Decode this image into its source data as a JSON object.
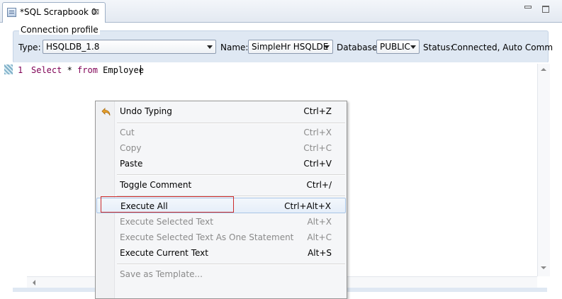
{
  "tab": {
    "title": "*SQL Scrapbook 0",
    "close": "⊠"
  },
  "connection": {
    "legend": "Connection profile",
    "type_label": "Type:",
    "type_value": "HSQLDB_1.8",
    "name_label": "Name:",
    "name_value": "SimpleHr HSQLDE",
    "database_label": "Database:",
    "database_value": "PUBLIC",
    "status_label": "Status:",
    "status_value": "Connected, Auto Comm"
  },
  "editor": {
    "line_number": "1",
    "kw_select": "Select",
    "mid": " * ",
    "kw_from": "from",
    "table": " Employee"
  },
  "menu": {
    "undo": {
      "label": "Undo Typing",
      "shortcut": "Ctrl+Z"
    },
    "cut": {
      "label": "Cut",
      "shortcut": "Ctrl+X"
    },
    "copy": {
      "label": "Copy",
      "shortcut": "Ctrl+C"
    },
    "paste": {
      "label": "Paste",
      "shortcut": "Ctrl+V"
    },
    "toggle_comment": {
      "label": "Toggle Comment",
      "shortcut": "Ctrl+/"
    },
    "execute_all": {
      "label": "Execute All",
      "shortcut": "Ctrl+Alt+X"
    },
    "execute_selected": {
      "label": "Execute Selected Text",
      "shortcut": "Alt+X"
    },
    "execute_selected_one": {
      "label": "Execute Selected Text As One Statement",
      "shortcut": "Alt+C"
    },
    "execute_current": {
      "label": "Execute Current Text",
      "shortcut": "Alt+S"
    },
    "save_template": {
      "label": "Save as Template..."
    }
  },
  "colors": {
    "keyword": "#7f0055",
    "highlight_box": "#cc2b2b",
    "panel_bg": "#dfe8f3"
  },
  "icons": [
    "sql-file-icon",
    "close-icon",
    "minimize-icon",
    "maximize-icon",
    "undo-icon",
    "chevron-down-icon"
  ]
}
